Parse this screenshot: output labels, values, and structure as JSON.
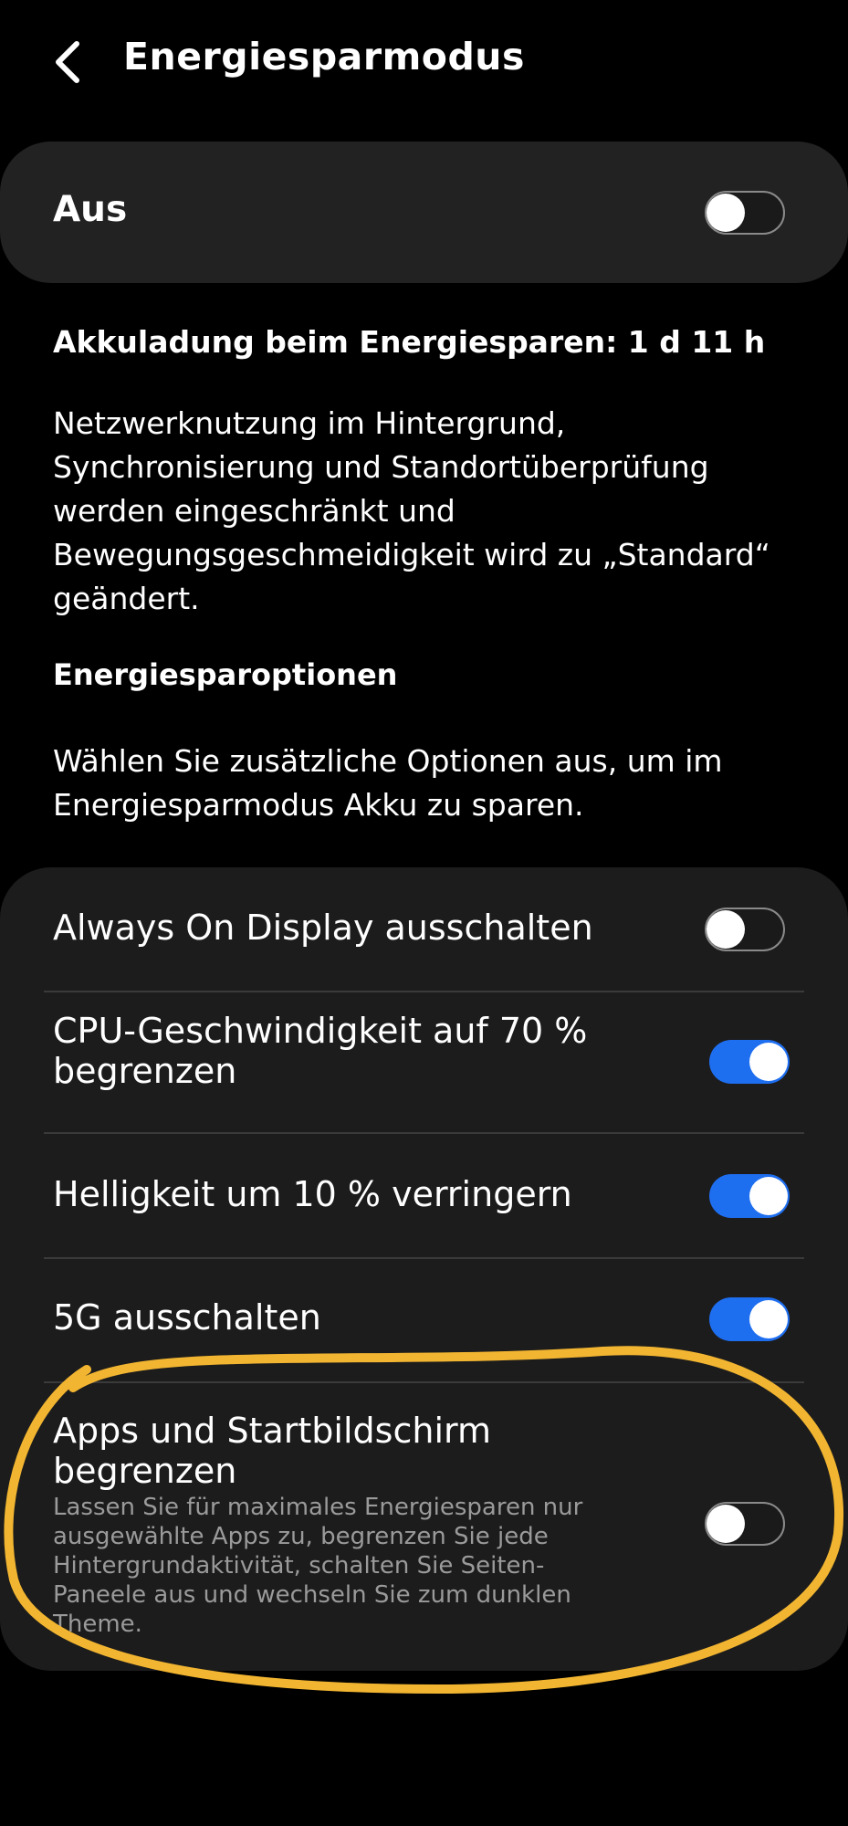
{
  "header": {
    "title": "Energiesparmodus",
    "back_icon": "chevron-left-icon"
  },
  "master": {
    "label": "Aus",
    "enabled": false
  },
  "estimate": "Akkuladung beim Energiesparen: 1 d 11 h",
  "description": "Netzwerknutzung im Hintergrund, Synchronisierung und Standortüberprüfung werden eingeschränkt und Bewegungsgeschmeidigkeit wird zu „Standard“ geändert.",
  "section": {
    "title": "Energiesparoptionen",
    "description": "Wählen Sie zusätzliche Optionen aus, um im Energiesparmodus Akku zu sparen."
  },
  "options": [
    {
      "label": "Always On Display ausschalten",
      "enabled": false
    },
    {
      "label": "CPU-Geschwindigkeit auf 70 % begrenzen",
      "enabled": true
    },
    {
      "label": "Helligkeit um 10 % verringern",
      "enabled": true
    },
    {
      "label": "5G ausschalten",
      "enabled": true
    },
    {
      "label": "Apps und Startbildschirm begrenzen",
      "sublabel": "Lassen Sie für maximales Energiesparen nur ausgewählte Apps zu, begrenzen Sie jede Hintergrundaktivität, schalten Sie Seiten-Paneele aus und wechseln Sie zum dunklen Theme.",
      "enabled": false
    }
  ],
  "colors": {
    "accent": "#1e6ef0",
    "highlight": "#f2b531",
    "card": "#222222"
  }
}
